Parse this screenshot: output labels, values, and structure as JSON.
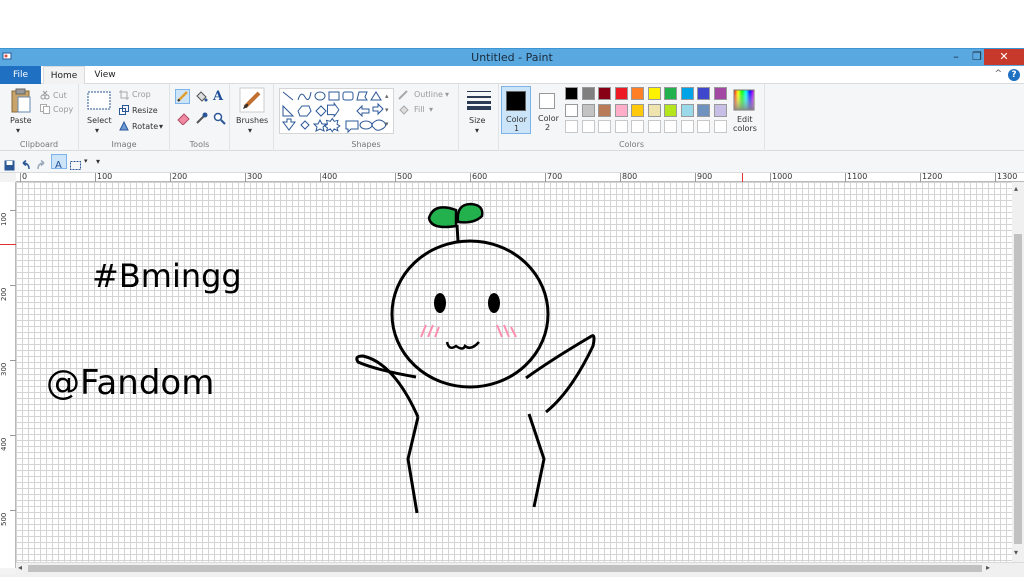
{
  "window": {
    "title": "Untitled - Paint",
    "minimize": "–",
    "maximize": "❐",
    "close": "✕"
  },
  "tabs": {
    "file": "File",
    "home": "Home",
    "view": "View",
    "collapse": "^",
    "help": "?"
  },
  "clipboard": {
    "paste": "Paste",
    "cut": "Cut",
    "copy": "Copy",
    "title": "Clipboard"
  },
  "image": {
    "select": "Select",
    "crop": "Crop",
    "resize": "Resize",
    "rotate": "Rotate",
    "title": "Image"
  },
  "tools": {
    "title": "Tools",
    "text_tool": "A"
  },
  "brushes": {
    "label": "Brushes"
  },
  "shapes": {
    "outline": "Outline",
    "fill": "Fill",
    "title": "Shapes"
  },
  "size": {
    "label": "Size"
  },
  "colors": {
    "color1_label_line1": "Color",
    "color1_label_line2": "1",
    "color2_label_line1": "Color",
    "color2_label_line2": "2",
    "edit_line1": "Edit",
    "edit_line2": "colors",
    "title": "Colors",
    "color1": "#000000",
    "color2": "#ffffff",
    "palette_row1": [
      "#000000",
      "#7f7f7f",
      "#880015",
      "#ed1c24",
      "#ff7f27",
      "#fff200",
      "#22b14c",
      "#00a2e8",
      "#3f48cc",
      "#a349a4"
    ],
    "palette_row2": [
      "#ffffff",
      "#c3c3c3",
      "#b97a57",
      "#ffaec9",
      "#ffc90e",
      "#efe4b0",
      "#b5e61d",
      "#99d9ea",
      "#7092be",
      "#c8bfe7"
    ]
  },
  "ruler": {
    "h_labels": [
      "0",
      "100",
      "200",
      "300",
      "400",
      "500",
      "600",
      "700",
      "800",
      "900",
      "1000",
      "1100",
      "1200",
      "1300"
    ],
    "v_labels": [
      "100",
      "200",
      "300",
      "400",
      "500"
    ]
  },
  "drawing": {
    "hashtag_text": "#Bmingg",
    "fandom_text": "@Fandom",
    "leaf_color": "#22b14c",
    "blush_color": "#ff8fb0",
    "ink_color": "#000000"
  }
}
